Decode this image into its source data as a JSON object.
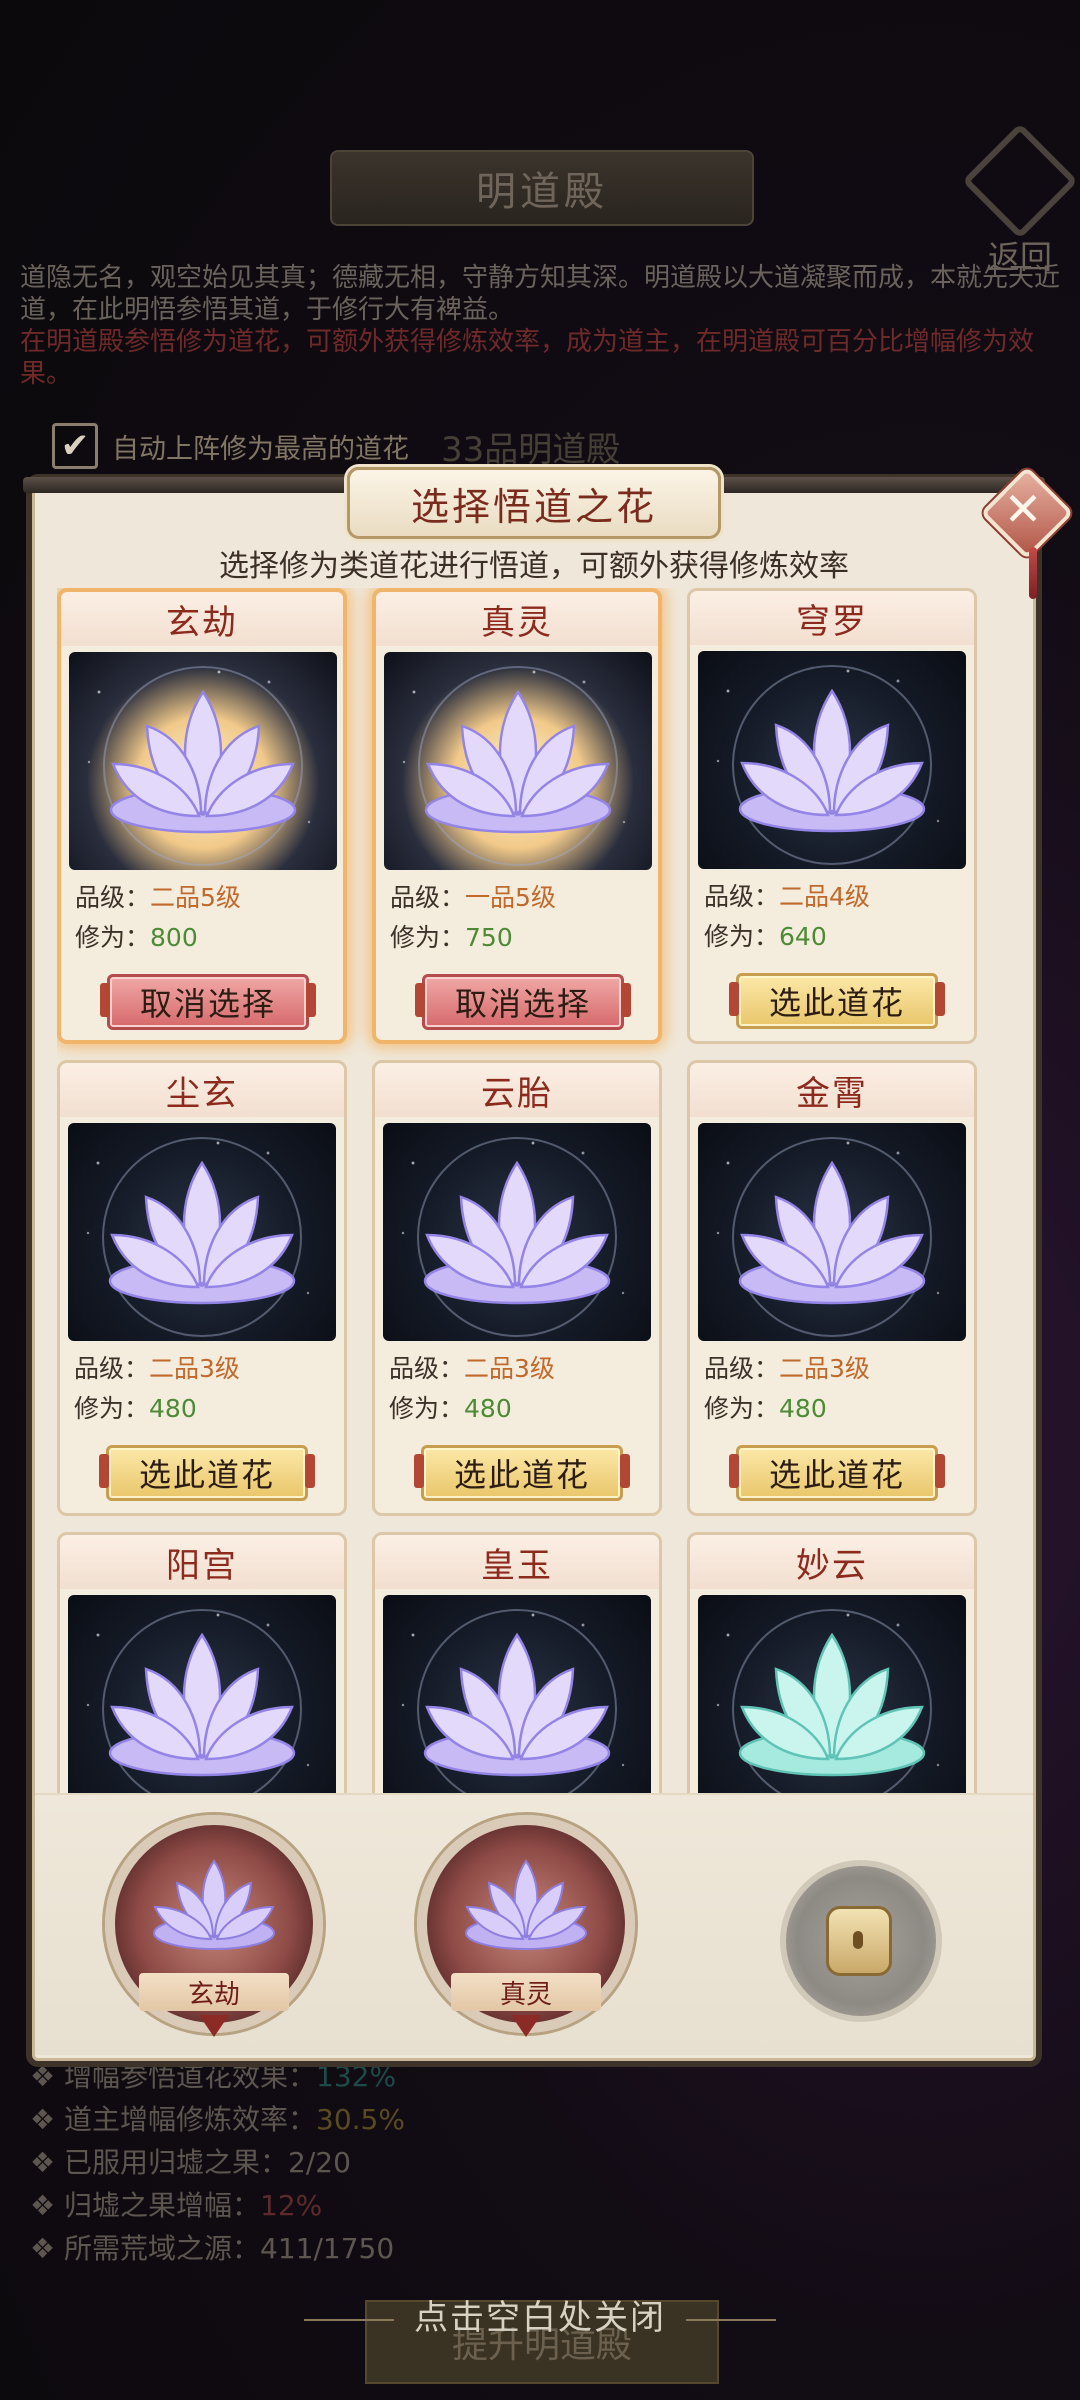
{
  "background": {
    "title": "明道殿",
    "back_label": "返回",
    "desc_line1": "道隐无名，观空始见其真；德藏无相，守静方知其深。明道殿以大道凝聚而成，本就先天近道，在此明悟参悟其道，于修行大有裨益。",
    "desc_line2": "在明道殿参悟修为道花，可额外获得修炼效率，成为道主，在明道殿可百分比增幅修为效果。",
    "auto_label": "自动上阵修为最高的道花",
    "hall_grade": "33品明道殿",
    "stats": [
      {
        "label": "增幅参悟道花效果：",
        "value": "132%"
      },
      {
        "label": "道主增幅修炼效率：",
        "value": "30.5%"
      },
      {
        "label": "已服用归墟之果：",
        "value": "2/20"
      },
      {
        "label": "归墟之果增幅：",
        "value": "12%"
      },
      {
        "label": "所需荒域之源：",
        "value": "411/1750"
      }
    ],
    "upgrade_label": "提升明道殿"
  },
  "close_hint": "点击空白处关闭",
  "modal": {
    "title": "选择悟道之花",
    "subtitle": "选择修为类道花进行悟道，可额外获得修炼效率",
    "grade_prefix": "品级：",
    "cult_prefix": "修为：",
    "cards": [
      {
        "name": "玄劫",
        "grade": "二品5级",
        "cultivation": "800",
        "button": "取消选择",
        "selected": true
      },
      {
        "name": "真灵",
        "grade": "一品5级",
        "cultivation": "750",
        "button": "取消选择",
        "selected": true
      },
      {
        "name": "穹罗",
        "grade": "二品4级",
        "cultivation": "640",
        "button": "选此道花",
        "selected": false
      },
      {
        "name": "尘玄",
        "grade": "二品3级",
        "cultivation": "480",
        "button": "选此道花",
        "selected": false
      },
      {
        "name": "云胎",
        "grade": "二品3级",
        "cultivation": "480",
        "button": "选此道花",
        "selected": false
      },
      {
        "name": "金霄",
        "grade": "二品3级",
        "cultivation": "480",
        "button": "选此道花",
        "selected": false
      },
      {
        "name": "阳宫",
        "grade": "",
        "cultivation": "",
        "button": "",
        "selected": false
      },
      {
        "name": "皇玉",
        "grade": "",
        "cultivation": "",
        "button": "",
        "selected": false
      },
      {
        "name": "妙云",
        "grade": "",
        "cultivation": "",
        "button": "",
        "selected": false
      }
    ],
    "tray": {
      "slots": [
        {
          "label": "玄劫"
        },
        {
          "label": "真灵"
        }
      ],
      "lock_icon": "lock-icon"
    }
  },
  "colors": {
    "accent_gold": "#e9c66a",
    "cancel_red": "#d6696c",
    "grade_orange": "#c0692b",
    "cultivation_green": "#4c8b35",
    "title_red": "#8b2a1d"
  }
}
